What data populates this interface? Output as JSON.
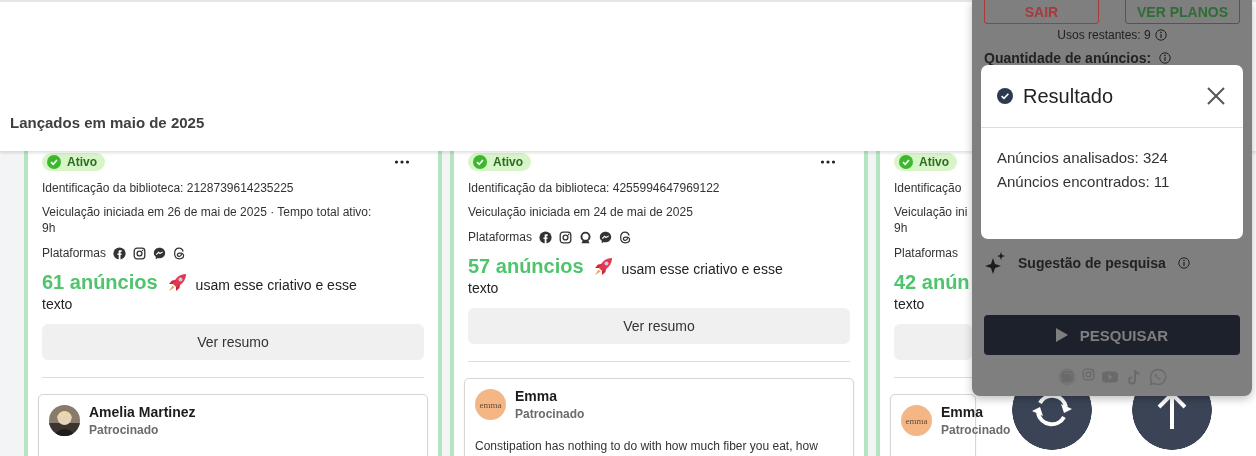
{
  "section_title": "Lançados em maio de 2025",
  "cards": [
    {
      "status": "Ativo",
      "more": true,
      "library_id": "Identificação da biblioteca: 2128739614235225",
      "run_info": [
        "Veiculação iniciada em 26 de mai de 2025 · Tempo total ativo:",
        "9h"
      ],
      "platforms_label": "Plataformas",
      "platforms": [
        {
          "kind": "facebook"
        },
        {
          "kind": "instagram"
        },
        {
          "kind": "messenger"
        },
        {
          "kind": "threads"
        }
      ],
      "ad_count": "61 anúncios",
      "rocket": true,
      "ad_count_rest": "usam esse criativo e esse",
      "ad_count_wrap": "texto",
      "summary_button": "Ver resumo",
      "advertiser": {
        "name": "Amelia Martinez",
        "subtitle": "Patrocinado"
      }
    },
    {
      "status": "Ativo",
      "more": true,
      "library_id": "Identificação da biblioteca: 4255994647969122",
      "run_info": [
        "Veiculação iniciada em 24 de mai de 2025"
      ],
      "platforms_label": "Plataformas",
      "platforms": [
        {
          "kind": "facebook"
        },
        {
          "kind": "instagram"
        },
        {
          "kind": "audience"
        },
        {
          "kind": "messenger"
        },
        {
          "kind": "threads"
        }
      ],
      "ad_count": "57 anúncios",
      "rocket": true,
      "ad_count_rest": "usam esse criativo e esse",
      "ad_count_wrap": "texto",
      "summary_button": "Ver resumo",
      "advertiser": {
        "name": "Emma",
        "subtitle": "Patrocinado",
        "avatar": {
          "kind": "logo",
          "text": "emma"
        },
        "body": "Constipation has nothing to do with how much fiber you eat, how"
      }
    },
    {
      "status": "Ativo",
      "more": false,
      "library_id": "Identificação",
      "run_info": [
        "Veiculação ini",
        "9h"
      ],
      "platforms_label": "Plataformas",
      "ad_count": "42 anún",
      "rocket": false,
      "ad_count_wrap": "texto",
      "advertiser": {
        "name": "Emma",
        "subtitle": "Patrocinado",
        "avatar": {
          "kind": "logo",
          "text": "emma"
        }
      }
    }
  ],
  "panel": {
    "logout_button": "SAIR",
    "plans_button": "VER PLANOS",
    "remaining_uses": "Usos restantes: 9",
    "ad_quantity_label": "Quantidade de anúncios:",
    "suggestion_label": "Sugestão de pesquisa",
    "search_button": "PESQUISAR",
    "social_links": [
      {
        "kind": "gallery"
      },
      {
        "kind": "instagram"
      },
      {
        "kind": "youtube"
      },
      {
        "kind": "tiktok"
      },
      {
        "kind": "whatsapp"
      }
    ]
  },
  "result_dialog": {
    "title": "Resultado",
    "lines": [
      "Anúncios analisados: 324",
      "Anúncios encontrados: 11"
    ]
  },
  "floating_buttons": [
    {
      "kind": "refresh"
    },
    {
      "kind": "scroll_top"
    }
  ]
}
